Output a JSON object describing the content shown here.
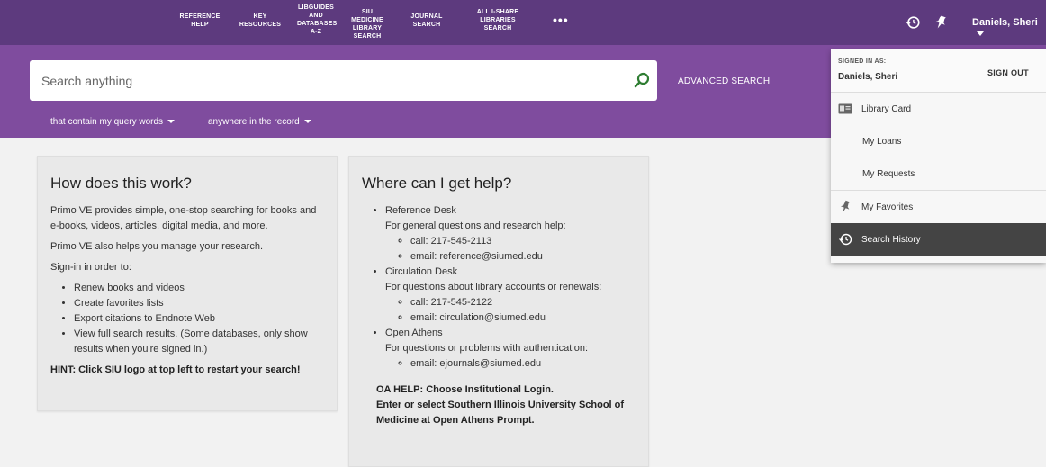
{
  "nav": {
    "items": [
      {
        "label": "REFERENCE HELP"
      },
      {
        "label": "KEY RESOURCES"
      },
      {
        "label": "LIBGUIDES AND DATABASES A-Z"
      },
      {
        "label": "SIU MEDICINE LIBRARY SEARCH"
      },
      {
        "label": "JOURNAL SEARCH"
      },
      {
        "label": "ALL I-SHARE LIBRARIES SEARCH"
      }
    ],
    "more": "•••",
    "user_name": "Daniels, Sheri"
  },
  "search": {
    "placeholder": "Search anything",
    "advanced_label": "ADVANCED SEARCH",
    "filter_1": "that contain my query words",
    "filter_2": "anywhere in the record"
  },
  "how": {
    "title": "How does this work?",
    "p1": "Primo VE provides simple, one-stop searching for books and e-books, videos, articles, digital media, and more.",
    "p2": "Primo VE also helps you manage your research.",
    "p3": "Sign-in in order to:",
    "bullets": [
      "Renew books and videos",
      "Create favorites lists",
      "Export citations to Endnote Web",
      "View full search results. (Some databases, only show results when you're signed in.)"
    ],
    "hint": "HINT: Click SIU logo at top left to restart your search!"
  },
  "help": {
    "title": "Where can I get help?",
    "desks": [
      {
        "name": "Reference Desk",
        "desc": "For general questions and research help:",
        "contacts": [
          "call: 217-545-2113",
          "email: reference@siumed.edu"
        ]
      },
      {
        "name": "Circulation Desk",
        "desc": "For questions about library accounts or renewals:",
        "contacts": [
          "call: 217-545-2122",
          "email: circulation@siumed.edu"
        ]
      },
      {
        "name": "Open Athens",
        "desc": "For questions or problems with authentication:",
        "contacts": [
          "email: ejournals@siumed.edu"
        ]
      }
    ],
    "oa_1": "OA HELP: Choose Institutional Login.",
    "oa_2": "Enter or select Southern Illinois University School of Medicine at Open Athens Prompt."
  },
  "dropdown": {
    "signed_in_as": "SIGNED IN AS:",
    "name": "Daniels, Sheri",
    "sign_out": "SIGN OUT",
    "library_card": "Library Card",
    "my_loans": "My Loans",
    "my_requests": "My Requests",
    "my_favorites": "My Favorites",
    "search_history": "Search History"
  },
  "colors": {
    "nav_bg": "#5d3a7e",
    "search_band": "#7f4c9e",
    "active_item": "#444444"
  }
}
